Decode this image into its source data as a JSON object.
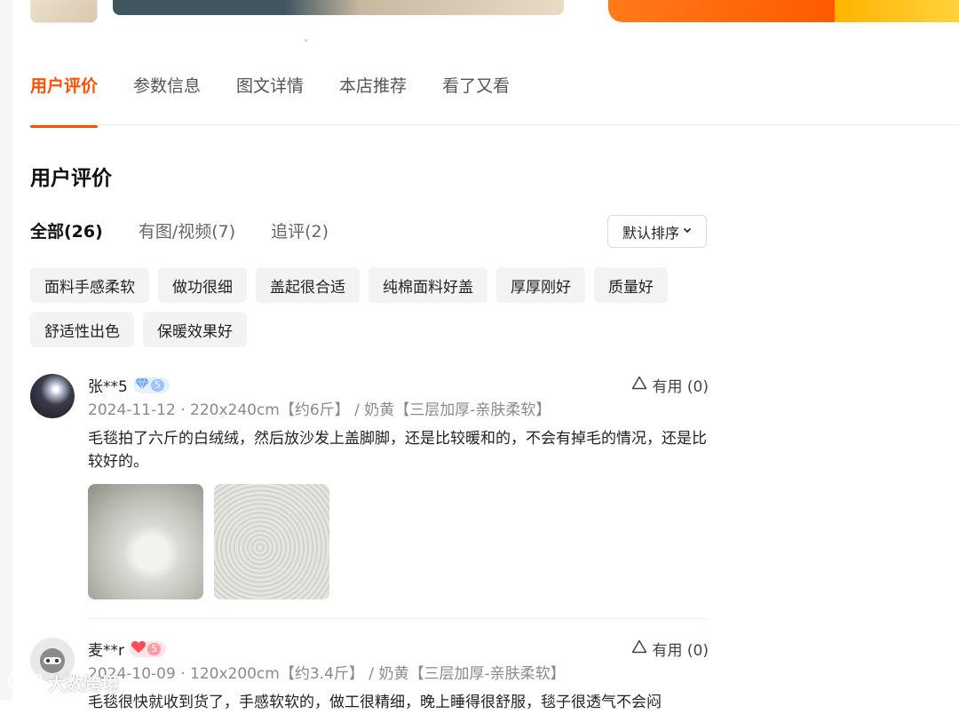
{
  "tabs": [
    {
      "label": "用户评价",
      "active": true
    },
    {
      "label": "参数信息",
      "active": false
    },
    {
      "label": "图文详情",
      "active": false
    },
    {
      "label": "本店推荐",
      "active": false
    },
    {
      "label": "看了又看",
      "active": false
    }
  ],
  "section_title": "用户评价",
  "filters": [
    {
      "label": "全部(26)",
      "active": true
    },
    {
      "label": "有图/视频(7)",
      "active": false
    },
    {
      "label": "追评(2)",
      "active": false
    }
  ],
  "sort": {
    "label": "默认排序"
  },
  "tags": [
    "面料手感柔软",
    "做功很细",
    "盖起很合适",
    "纯棉面料好盖",
    "厚厚刚好",
    "质量好",
    "舒适性出色",
    "保暖效果好"
  ],
  "reviews": [
    {
      "user": "张**5",
      "level_icon": "diamond-icon",
      "level": "5",
      "useful": "有用 (0)",
      "meta": "2024-11-12 · 220x240cm【约6斤】 / 奶黄【三层加厚-亲肤柔软】",
      "content": "毛毯拍了六斤的白绒绒，然后放沙发上盖脚脚，还是比较暖和的，不会有掉毛的情况，还是比较好的。"
    },
    {
      "user": "麦**r",
      "level_icon": "heart-icon",
      "level": "5",
      "useful": "有用 (0)",
      "meta": "2024-10-09 · 120x200cm【约3.4斤】 / 奶黄【三层加厚-亲肤柔软】",
      "content": "毛毯很快就收到货了，手感软软的，做工很精细，晚上睡得很舒服，毯子很透气不会闷"
    }
  ],
  "watermark": "大数跨境",
  "colors": {
    "accent": "#ff5000",
    "tag_bg": "#f2f3f5"
  }
}
